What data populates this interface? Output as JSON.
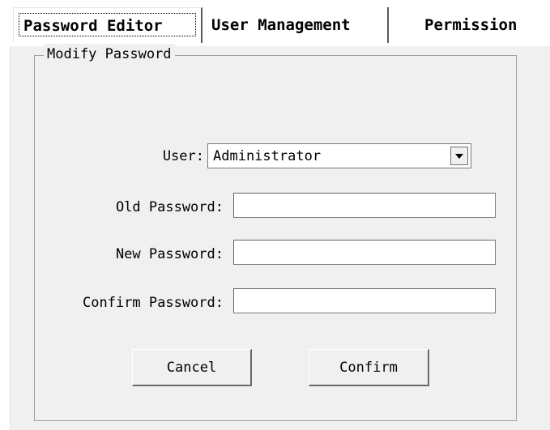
{
  "tabs": [
    {
      "label": "Password Editor",
      "active": true
    },
    {
      "label": "User Management",
      "active": false
    },
    {
      "label": "Permission",
      "active": false
    }
  ],
  "group": {
    "title": "Modify Password"
  },
  "form": {
    "user_label": "User:",
    "user_value": "Administrator",
    "old_password_label": "Old Password:",
    "old_password_value": "",
    "new_password_label": "New Password:",
    "new_password_value": "",
    "confirm_password_label": "Confirm Password:",
    "confirm_password_value": ""
  },
  "buttons": {
    "cancel": "Cancel",
    "confirm": "Confirm"
  },
  "icons": {
    "combo_dropdown": "chevron-down-icon"
  }
}
